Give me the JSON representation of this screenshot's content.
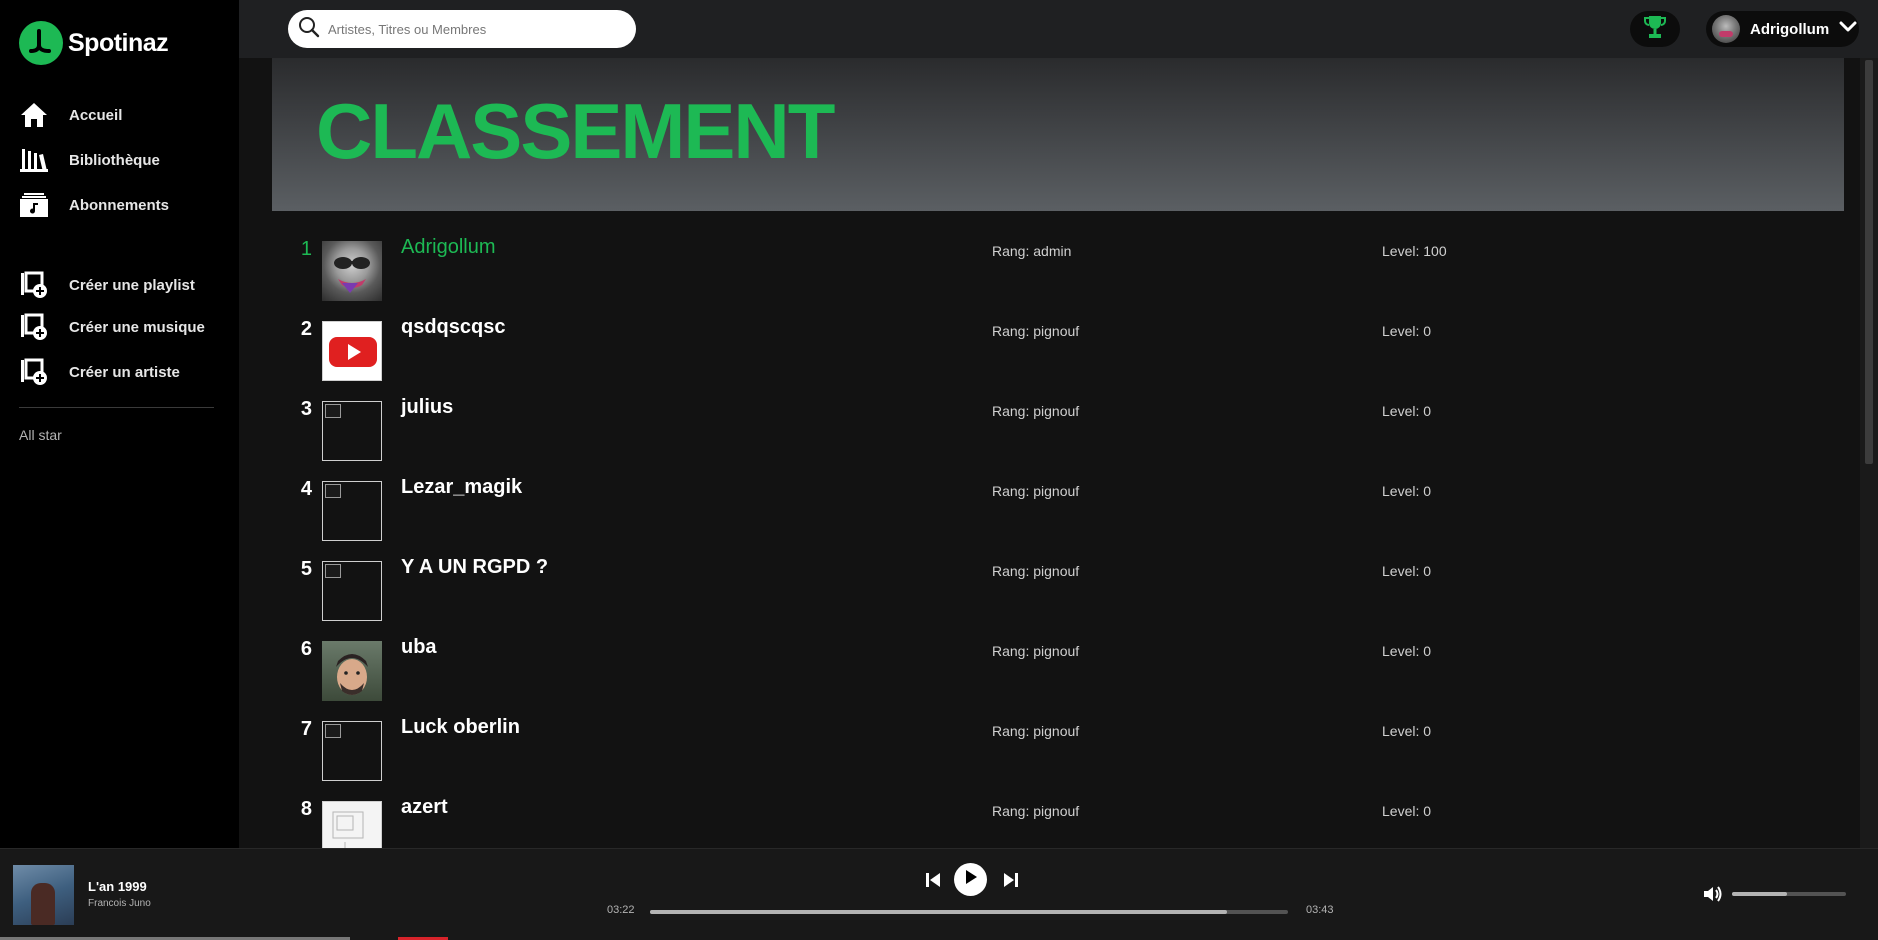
{
  "brand": {
    "name": "Spotinaz",
    "color": "#1db954"
  },
  "nav": {
    "main": [
      {
        "label": "Accueil",
        "icon": "home-icon"
      },
      {
        "label": "Bibliothèque",
        "icon": "library-icon"
      },
      {
        "label": "Abonnements",
        "icon": "subscriptions-icon"
      }
    ],
    "create": [
      {
        "label": "Créer une playlist",
        "icon": "add-playlist-icon"
      },
      {
        "label": "Créer une musique",
        "icon": "add-music-icon"
      },
      {
        "label": "Créer un artiste",
        "icon": "add-artist-icon"
      }
    ],
    "playlists": [
      {
        "label": "All star"
      }
    ]
  },
  "search": {
    "placeholder": "Artistes, Titres ou Membres"
  },
  "topbar": {
    "trophy_icon": "trophy-icon",
    "user": {
      "name": "Adrigollum",
      "dropdown_icon": "chevron-down-icon"
    }
  },
  "page": {
    "title": "CLASSEMENT"
  },
  "ranking": [
    {
      "rank": "1",
      "name": "Adrigollum",
      "rang": "Rang: admin",
      "level": "Level: 100",
      "avatar": "goblin-avatar"
    },
    {
      "rank": "2",
      "name": "qsdqscqsc",
      "rang": "Rang: pignouf",
      "level": "Level: 0",
      "avatar": "youtube-logo"
    },
    {
      "rank": "3",
      "name": "julius",
      "rang": "Rang: pignouf",
      "level": "Level: 0",
      "avatar": "broken-image"
    },
    {
      "rank": "4",
      "name": "Lezar_magik",
      "rang": "Rang: pignouf",
      "level": "Level: 0",
      "avatar": "broken-image"
    },
    {
      "rank": "5",
      "name": "Y A UN RGPD ?",
      "rang": "Rang: pignouf",
      "level": "Level: 0",
      "avatar": "broken-image"
    },
    {
      "rank": "6",
      "name": "uba",
      "rang": "Rang: pignouf",
      "level": "Level: 0",
      "avatar": "photo-avatar"
    },
    {
      "rank": "7",
      "name": "Luck oberlin",
      "rang": "Rang: pignouf",
      "level": "Level: 0",
      "avatar": "broken-image"
    },
    {
      "rank": "8",
      "name": "azert",
      "rang": "Rang: pignouf",
      "level": "Level: 0",
      "avatar": "sketch-avatar"
    }
  ],
  "player": {
    "title": "L'an 1999",
    "artist": "Francois Juno",
    "current_time": "03:22",
    "total_time": "03:43",
    "progress": 0.905,
    "volume": 0.48
  }
}
